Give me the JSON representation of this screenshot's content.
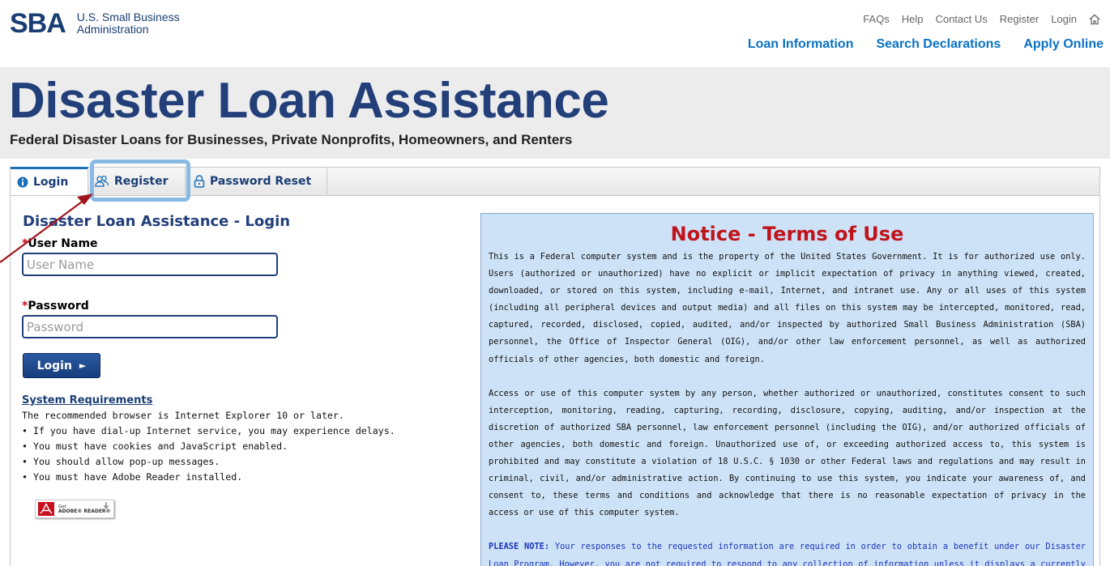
{
  "header": {
    "logo_mark": "SBA",
    "logo_line1": "U.S. Small Business",
    "logo_line2": "Administration",
    "top_links": [
      "FAQs",
      "Help",
      "Contact Us",
      "Register",
      "Login"
    ],
    "main_nav": [
      "Loan Information",
      "Search Declarations",
      "Apply Online"
    ]
  },
  "banner": {
    "title": "Disaster Loan Assistance",
    "subtitle": "Federal Disaster Loans for Businesses, Private Nonprofits, Homeowners, and Renters"
  },
  "tabs": [
    {
      "label": "Login",
      "active": true
    },
    {
      "label": "Register",
      "active": false
    },
    {
      "label": "Password Reset",
      "active": false
    }
  ],
  "login": {
    "title": "Disaster Loan Assistance - Login",
    "required_mark": "*",
    "username_label": "User Name",
    "username_placeholder": "User Name",
    "password_label": "Password",
    "password_placeholder": "Password",
    "button_label": "Login",
    "button_arrow": "►"
  },
  "requirements": {
    "heading": "System Requirements",
    "lines": [
      "The recommended browser is Internet Explorer 10 or later.",
      "• If you have dial-up Internet service, you may experience delays.",
      "• You must have cookies and JavaScript enabled.",
      "• You should allow pop-up messages.",
      "• You must have Adobe Reader installed."
    ],
    "adobe_get": "Get",
    "adobe_name": "ADOBE® READER®"
  },
  "notice": {
    "title": "Notice - Terms of Use",
    "para1": "This is a Federal computer system and is the property of the United States Government. It is for authorized use only. Users (authorized or unauthorized) have no explicit or implicit expectation of privacy in anything viewed, created, downloaded, or stored on this system, including e-mail, Internet, and intranet use. Any or all uses of this system (including all peripheral devices and output media) and all files on this system may be intercepted, monitored, read, captured, recorded, disclosed, copied, audited, and/or inspected by authorized Small Business Administration (SBA) personnel, the Office of Inspector General (OIG), and/or other law enforcement personnel, as well as authorized officials of other agencies, both domestic and foreign.",
    "para2": "Access or use of this computer system by any person, whether authorized or unauthorized, constitutes consent to such interception, monitoring, reading, capturing, recording, disclosure, copying, auditing, and/or inspection at the discretion of authorized SBA personnel, law enforcement personnel (including the OIG), and/or authorized officials of other agencies, both domestic and foreign. Unauthorized use of, or exceeding authorized access to, this system is prohibited and may constitute a violation of 18 U.S.C. § 1030 or other Federal laws and regulations and may result in criminal, civil, and/or administrative action. By continuing to use this system, you indicate your awareness of, and consent to, these terms and conditions and acknowledge that there is no reasonable expectation of privacy in the access or use of this computer system.",
    "note_label": "PLEASE NOTE:",
    "note_text": " Your responses to the requested information are required in order to obtain a benefit under our Disaster Loan Program. However, you are not required to respond to any collection of information unless it displays a currently valid OMB control number."
  },
  "colors": {
    "brand_navy": "#1a3e74",
    "nav_blue": "#0a72c4",
    "required_red": "#c0141c",
    "notice_bg": "#cde2f6",
    "highlight": "#8ab9e3",
    "annotation_arrow": "#a0151c"
  }
}
